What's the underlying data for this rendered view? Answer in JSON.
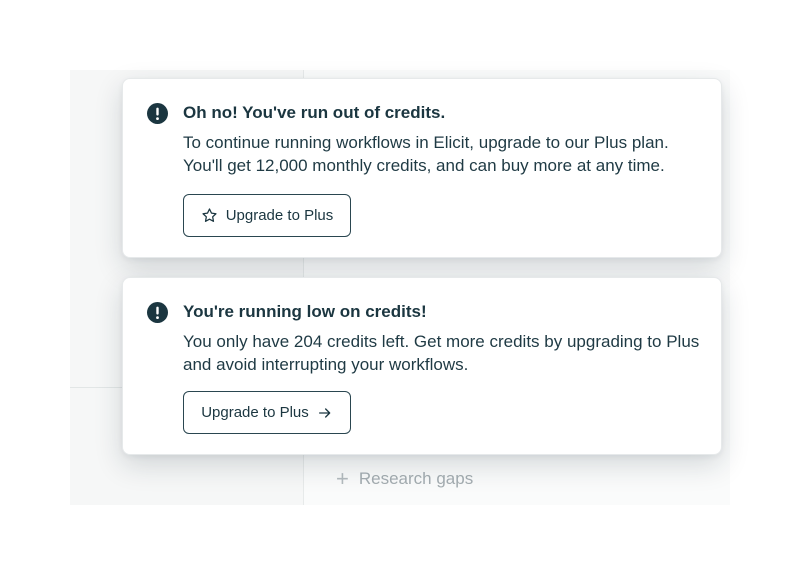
{
  "background": {
    "sidebar_item": {
      "icon": "plus-icon",
      "label": "Research gaps"
    }
  },
  "notifications": [
    {
      "icon": "exclamation-circle-icon",
      "title": "Oh no! You've run out of credits.",
      "body": "To continue running workflows in Elicit, upgrade to our Plus plan. You'll get 12,000 monthly credits, and can buy more at any time.",
      "button": {
        "label": "Upgrade to Plus",
        "icon": "star-icon",
        "icon_position": "leading"
      }
    },
    {
      "icon": "exclamation-circle-icon",
      "title": "You're running low on credits!",
      "body": "You only have 204 credits left. Get more credits by upgrading to Plus and avoid interrupting your workflows.",
      "button": {
        "label": "Upgrade to Plus",
        "icon": "arrow-right-icon",
        "icon_position": "trailing"
      }
    }
  ],
  "colors": {
    "text": "#1b3640",
    "icon_fill": "#1b3640",
    "muted": "#a4adb1",
    "card_bg": "#ffffff"
  }
}
